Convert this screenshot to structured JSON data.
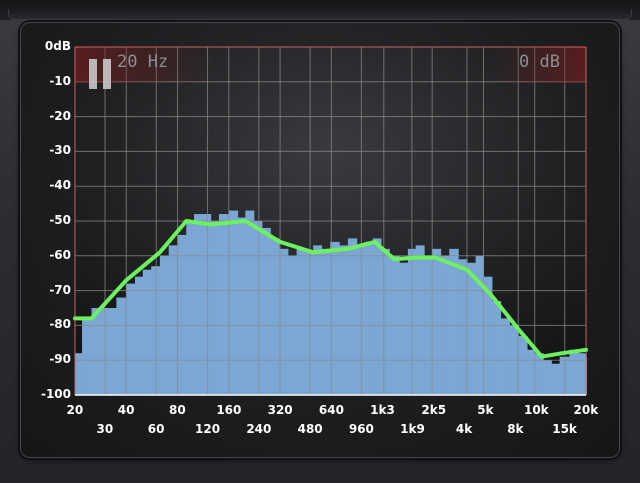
{
  "overlay": {
    "frequency_readout": "20 Hz",
    "level_readout": "0 dB"
  },
  "colors": {
    "spectrum_fill": "#7ba7d4",
    "curve": "#6cf25e",
    "grid": "#8a8a8a",
    "border_top": "#d06060"
  },
  "chart_data": {
    "type": "area",
    "x_scale": "log",
    "xlim": [
      20,
      20000
    ],
    "ylim": [
      -100,
      0
    ],
    "y_ticks": [
      "0dB",
      "-10",
      "-20",
      "-30",
      "-40",
      "-50",
      "-60",
      "-70",
      "-80",
      "-90",
      "-100"
    ],
    "x_ticks_top": [
      "20",
      "40",
      "80",
      "160",
      "320",
      "640",
      "1k3",
      "2k5",
      "5k",
      "10k",
      "20k"
    ],
    "x_ticks_bottom": [
      "30",
      "60",
      "120",
      "240",
      "480",
      "960",
      "1k9",
      "4k",
      "8k",
      "15k"
    ],
    "spectrum": {
      "x": [
        20,
        22,
        25,
        28,
        31,
        35,
        40,
        45,
        50,
        56,
        63,
        71,
        80,
        90,
        100,
        112,
        125,
        140,
        160,
        180,
        200,
        224,
        250,
        280,
        315,
        355,
        400,
        450,
        500,
        560,
        630,
        710,
        800,
        900,
        1000,
        1120,
        1250,
        1400,
        1600,
        1800,
        2000,
        2240,
        2500,
        2800,
        3150,
        3550,
        4000,
        4500,
        5000,
        5600,
        6300,
        7100,
        8000,
        9000,
        10000,
        11200,
        12500,
        14000,
        16000,
        18000,
        20000
      ],
      "y": [
        -88,
        -78,
        -75,
        -75,
        -75,
        -72,
        -68,
        -66,
        -64,
        -63,
        -60,
        -57,
        -54,
        -50,
        -48,
        -48,
        -50,
        -48,
        -47,
        -49,
        -47,
        -50,
        -52,
        -55,
        -58,
        -60,
        -58,
        -59,
        -57,
        -58,
        -56,
        -57,
        -55,
        -57,
        -56,
        -55,
        -58,
        -60,
        -62,
        -58,
        -57,
        -60,
        -58,
        -60,
        -58,
        -61,
        -62,
        -60,
        -66,
        -73,
        -78,
        -80,
        -83,
        -87,
        -88,
        -90,
        -91,
        -89,
        -87,
        -88,
        -89
      ]
    },
    "curve": {
      "x": [
        20,
        25,
        40,
        63,
        90,
        125,
        200,
        320,
        500,
        800,
        1150,
        1500,
        2000,
        2600,
        4000,
        5500,
        8000,
        11000,
        14500,
        20000
      ],
      "y": [
        -78,
        -78,
        -67,
        -59,
        -50,
        -51,
        -50,
        -56,
        -59,
        -58,
        -56,
        -61,
        -60.5,
        -60.5,
        -64,
        -71,
        -81,
        -89,
        -88,
        -87
      ]
    }
  }
}
